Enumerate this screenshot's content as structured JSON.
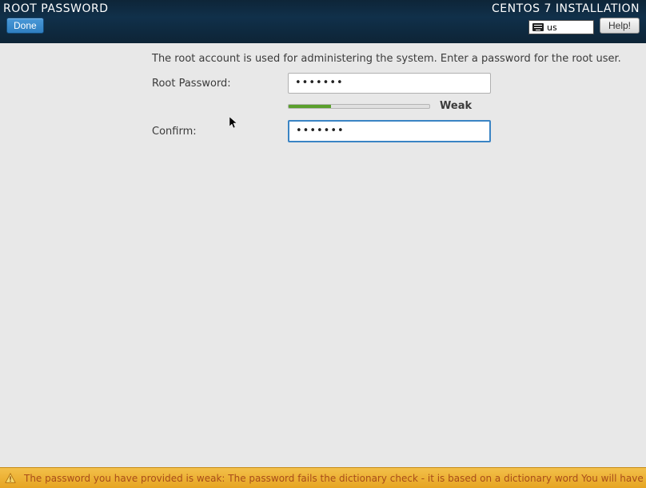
{
  "header": {
    "title": "ROOT PASSWORD",
    "done_label": "Done",
    "subtitle": "CENTOS 7 INSTALLATION",
    "keyboard_layout": "us",
    "help_label": "Help!"
  },
  "form": {
    "instructions": "The root account is used for administering the system.  Enter a password for the root user.",
    "root_label": "Root Password:",
    "root_value": "•••••••",
    "confirm_label": "Confirm:",
    "confirm_value": "•••••••",
    "strength_percent": 30,
    "strength_text": "Weak"
  },
  "warning": {
    "message": "The password you have provided is weak: The password fails the dictionary check - it is based on a dictionary word You will have to press Done twice to confirm it."
  }
}
